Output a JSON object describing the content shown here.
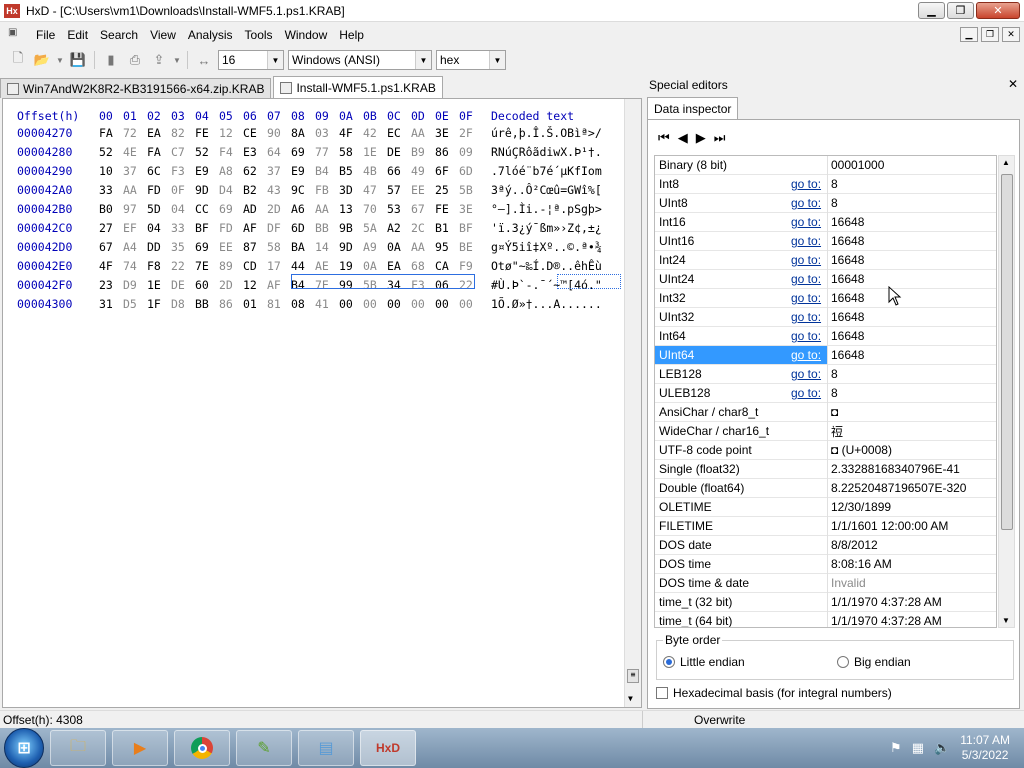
{
  "window": {
    "title": "HxD - [C:\\Users\\vm1\\Downloads\\Install-WMF5.1.ps1.KRAB]",
    "app_icon_text": "Hx"
  },
  "menu": [
    "File",
    "Edit",
    "Search",
    "View",
    "Analysis",
    "Tools",
    "Window",
    "Help"
  ],
  "toolbar": {
    "bytes_per_row": "16",
    "encoding": "Windows (ANSI)",
    "display_mode": "hex"
  },
  "tabs": [
    {
      "label": "Win7AndW2K8R2-KB3191566-x64.zip.KRAB",
      "active": false
    },
    {
      "label": "Install-WMF5.1.ps1.KRAB",
      "active": true
    }
  ],
  "hex_view": {
    "offset_header": "Offset(h)",
    "column_headers": [
      "00",
      "01",
      "02",
      "03",
      "04",
      "05",
      "06",
      "07",
      "08",
      "09",
      "0A",
      "0B",
      "0C",
      "0D",
      "0E",
      "0F"
    ],
    "decoded_header": "Decoded text",
    "rows": [
      {
        "offset": "00004270",
        "bytes": [
          "FA",
          "72",
          "EA",
          "82",
          "FE",
          "12",
          "CE",
          "90",
          "8A",
          "03",
          "4F",
          "42",
          "EC",
          "AA",
          "3E",
          "2F"
        ],
        "text": "úrê‚þ.Î.Š.OBìª>/"
      },
      {
        "offset": "00004280",
        "bytes": [
          "52",
          "4E",
          "FA",
          "C7",
          "52",
          "F4",
          "E3",
          "64",
          "69",
          "77",
          "58",
          "1E",
          "DE",
          "B9",
          "86",
          "09"
        ],
        "text": "RNúÇRôãdiwX.Þ¹†."
      },
      {
        "offset": "00004290",
        "bytes": [
          "10",
          "37",
          "6C",
          "F3",
          "E9",
          "A8",
          "62",
          "37",
          "E9",
          "B4",
          "B5",
          "4B",
          "66",
          "49",
          "6F",
          "6D"
        ],
        "text": ".7lóé¨b7é´µKfIom"
      },
      {
        "offset": "000042A0",
        "bytes": [
          "33",
          "AA",
          "FD",
          "0F",
          "9D",
          "D4",
          "B2",
          "43",
          "9C",
          "FB",
          "3D",
          "47",
          "57",
          "EE",
          "25",
          "5B"
        ],
        "text": "3ªý..Ô²Cœû=GWî%["
      },
      {
        "offset": "000042B0",
        "bytes": [
          "B0",
          "97",
          "5D",
          "04",
          "CC",
          "69",
          "AD",
          "2D",
          "A6",
          "AA",
          "13",
          "70",
          "53",
          "67",
          "FE",
          "3E"
        ],
        "text": "°—].Ìi.-¦ª.pSgþ>"
      },
      {
        "offset": "000042C0",
        "bytes": [
          "27",
          "EF",
          "04",
          "33",
          "BF",
          "FD",
          "AF",
          "DF",
          "6D",
          "BB",
          "9B",
          "5A",
          "A2",
          "2C",
          "B1",
          "BF"
        ],
        "text": "'ï.3¿ý¯ßm»›Z¢,±¿"
      },
      {
        "offset": "000042D0",
        "bytes": [
          "67",
          "A4",
          "DD",
          "35",
          "69",
          "EE",
          "87",
          "58",
          "BA",
          "14",
          "9D",
          "A9",
          "0A",
          "AA",
          "95",
          "BE"
        ],
        "text": "g¤Ý5iî‡Xº..©.ª•¾"
      },
      {
        "offset": "000042E0",
        "bytes": [
          "4F",
          "74",
          "F8",
          "22",
          "7E",
          "89",
          "CD",
          "17",
          "44",
          "AE",
          "19",
          "0A",
          "EA",
          "68",
          "CA",
          "F9"
        ],
        "text": "Otø\"~‰Í.D®..êhÊù"
      },
      {
        "offset": "000042F0",
        "bytes": [
          "23",
          "D9",
          "1E",
          "DE",
          "60",
          "2D",
          "12",
          "AF",
          "B4",
          "7E",
          "99",
          "5B",
          "34",
          "F3",
          "06",
          "22"
        ],
        "text": "#Ù.Þ`-.¯´~™[4ó.\""
      },
      {
        "offset": "00004300",
        "bytes": [
          "31",
          "D5",
          "1F",
          "D8",
          "BB",
          "86",
          "01",
          "81",
          "08",
          "41",
          "00",
          "00",
          "00",
          "00",
          "00",
          "00"
        ],
        "text": "1Õ.Ø»†..",
        "text_selected": ".A......"
      }
    ]
  },
  "special_editors": {
    "title": "Special editors",
    "tab": "Data inspector",
    "goto_label": "go to:",
    "rows": [
      {
        "name": "Binary (8 bit)",
        "goto": false,
        "value": "00001000"
      },
      {
        "name": "Int8",
        "goto": true,
        "value": "8"
      },
      {
        "name": "UInt8",
        "goto": true,
        "value": "8"
      },
      {
        "name": "Int16",
        "goto": true,
        "value": "16648"
      },
      {
        "name": "UInt16",
        "goto": true,
        "value": "16648"
      },
      {
        "name": "Int24",
        "goto": true,
        "value": "16648"
      },
      {
        "name": "UInt24",
        "goto": true,
        "value": "16648"
      },
      {
        "name": "Int32",
        "goto": true,
        "value": "16648"
      },
      {
        "name": "UInt32",
        "goto": true,
        "value": "16648"
      },
      {
        "name": "Int64",
        "goto": true,
        "value": "16648"
      },
      {
        "name": "UInt64",
        "goto": true,
        "value": "16648",
        "selected": true
      },
      {
        "name": "LEB128",
        "goto": true,
        "value": "8"
      },
      {
        "name": "ULEB128",
        "goto": true,
        "value": "8"
      },
      {
        "name": "AnsiChar / char8_t",
        "goto": false,
        "value": "◘"
      },
      {
        "name": "WideChar / char16_t",
        "goto": false,
        "value": "䄈"
      },
      {
        "name": "UTF-8 code point",
        "goto": false,
        "value": "◘ (U+0008)"
      },
      {
        "name": "Single (float32)",
        "goto": false,
        "value": "2.33288168340796E-41"
      },
      {
        "name": "Double (float64)",
        "goto": false,
        "value": "8.22520487196507E-320"
      },
      {
        "name": "OLETIME",
        "goto": false,
        "value": "12/30/1899"
      },
      {
        "name": "FILETIME",
        "goto": false,
        "value": "1/1/1601 12:00:00 AM"
      },
      {
        "name": "DOS date",
        "goto": false,
        "value": "8/8/2012"
      },
      {
        "name": "DOS time",
        "goto": false,
        "value": "8:08:16 AM"
      },
      {
        "name": "DOS time & date",
        "goto": false,
        "value": "Invalid",
        "muted": true
      },
      {
        "name": "time_t (32 bit)",
        "goto": false,
        "value": "1/1/1970 4:37:28 AM"
      },
      {
        "name": "time_t (64 bit)",
        "goto": false,
        "value": "1/1/1970 4:37:28 AM"
      }
    ],
    "byte_order_label": "Byte order",
    "little_endian": "Little endian",
    "big_endian": "Big endian",
    "hex_basis": "Hexadecimal basis (for integral numbers)"
  },
  "status": {
    "offset": "Offset(h): 4308",
    "mode": "Overwrite"
  },
  "taskbar": {
    "time": "11:07 AM",
    "date": "5/3/2022"
  }
}
